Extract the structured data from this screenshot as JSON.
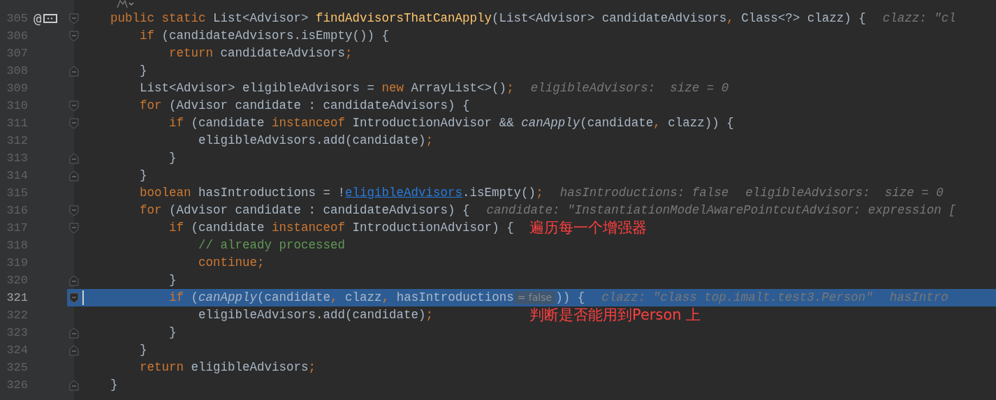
{
  "lines": [
    {
      "number": "305",
      "current": false,
      "fold_open": true,
      "fold_close": false,
      "gutter_text": "@",
      "debug_badge": true,
      "tokens": [
        {
          "kind": "keyword",
          "text": "public static "
        },
        {
          "kind": "plain",
          "text": "List<Advisor> "
        },
        {
          "kind": "method",
          "text": "findAdvisorsThatCanApply"
        },
        {
          "kind": "plain",
          "text": "(List<Advisor> candidateAdvisors"
        },
        {
          "kind": "punct",
          "text": ", "
        },
        {
          "kind": "plain",
          "text": "Class<?> clazz) {"
        },
        {
          "kind": "hint",
          "text": "clazz: \"cl"
        }
      ]
    },
    {
      "number": "306",
      "current": false,
      "fold_open": true,
      "fold_close": false,
      "debug_badge": false,
      "tokens": [
        {
          "kind": "keyword",
          "text": "    if "
        },
        {
          "kind": "plain",
          "text": "(candidateAdvisors.isEmpty()) {"
        }
      ]
    },
    {
      "number": "307",
      "current": false,
      "fold_open": false,
      "fold_close": false,
      "debug_badge": false,
      "tokens": [
        {
          "kind": "keyword",
          "text": "        return "
        },
        {
          "kind": "plain",
          "text": "candidateAdvisors"
        },
        {
          "kind": "punct",
          "text": ";"
        }
      ]
    },
    {
      "number": "308",
      "current": false,
      "fold_open": false,
      "fold_close": true,
      "debug_badge": false,
      "tokens": [
        {
          "kind": "plain",
          "text": "    }"
        }
      ]
    },
    {
      "number": "309",
      "current": false,
      "fold_open": false,
      "fold_close": false,
      "debug_badge": false,
      "tokens": [
        {
          "kind": "plain",
          "text": "    List<Advisor> eligibleAdvisors = "
        },
        {
          "kind": "keyword",
          "text": "new "
        },
        {
          "kind": "plain",
          "text": "ArrayList<>()"
        },
        {
          "kind": "punct",
          "text": ";"
        },
        {
          "kind": "hint",
          "text": "eligibleAdvisors:  size = 0"
        }
      ]
    },
    {
      "number": "310",
      "current": false,
      "fold_open": true,
      "fold_close": false,
      "debug_badge": false,
      "tokens": [
        {
          "kind": "keyword",
          "text": "    for "
        },
        {
          "kind": "plain",
          "text": "(Advisor candidate : candidateAdvisors) {"
        }
      ]
    },
    {
      "number": "311",
      "current": false,
      "fold_open": true,
      "fold_close": false,
      "debug_badge": false,
      "tokens": [
        {
          "kind": "keyword",
          "text": "        if "
        },
        {
          "kind": "plain",
          "text": "(candidate "
        },
        {
          "kind": "keyword",
          "text": "instanceof "
        },
        {
          "kind": "plain",
          "text": "IntroductionAdvisor && "
        },
        {
          "kind": "italic",
          "text": "canApply"
        },
        {
          "kind": "plain",
          "text": "(candidate"
        },
        {
          "kind": "punct",
          "text": ", "
        },
        {
          "kind": "plain",
          "text": "clazz)) {"
        }
      ]
    },
    {
      "number": "312",
      "current": false,
      "fold_open": false,
      "fold_close": false,
      "debug_badge": false,
      "tokens": [
        {
          "kind": "plain",
          "text": "            eligibleAdvisors.add(candidate)"
        },
        {
          "kind": "punct",
          "text": ";"
        }
      ]
    },
    {
      "number": "313",
      "current": false,
      "fold_open": false,
      "fold_close": true,
      "debug_badge": false,
      "tokens": [
        {
          "kind": "plain",
          "text": "        }"
        }
      ]
    },
    {
      "number": "314",
      "current": false,
      "fold_open": false,
      "fold_close": true,
      "debug_badge": false,
      "tokens": [
        {
          "kind": "plain",
          "text": "    }"
        }
      ]
    },
    {
      "number": "315",
      "current": false,
      "fold_open": false,
      "fold_close": false,
      "debug_badge": false,
      "tokens": [
        {
          "kind": "keyword",
          "text": "    boolean "
        },
        {
          "kind": "plain",
          "text": "hasIntroductions = !"
        },
        {
          "kind": "link",
          "text": "eligibleAdvisors"
        },
        {
          "kind": "plain",
          "text": ".isEmpty()"
        },
        {
          "kind": "punct",
          "text": ";"
        },
        {
          "kind": "hint",
          "text": "hasIntroductions: false"
        },
        {
          "kind": "hint",
          "text": "eligibleAdvisors:  size = 0"
        }
      ]
    },
    {
      "number": "316",
      "current": false,
      "fold_open": true,
      "fold_close": false,
      "debug_badge": false,
      "tokens": [
        {
          "kind": "keyword",
          "text": "    for "
        },
        {
          "kind": "plain",
          "text": "(Advisor candidate : candidateAdvisors) {"
        },
        {
          "kind": "hint",
          "text": "candidate: \"InstantiationModelAwarePointcutAdvisor: expression ["
        }
      ]
    },
    {
      "number": "317",
      "current": false,
      "fold_open": true,
      "fold_close": false,
      "debug_badge": false,
      "note": "遍历每一个增强器",
      "tokens": [
        {
          "kind": "keyword",
          "text": "        if "
        },
        {
          "kind": "plain",
          "text": "(candidate "
        },
        {
          "kind": "keyword",
          "text": "instanceof "
        },
        {
          "kind": "plain",
          "text": "IntroductionAdvisor) {"
        }
      ]
    },
    {
      "number": "318",
      "current": false,
      "fold_open": false,
      "fold_close": false,
      "debug_badge": false,
      "tokens": [
        {
          "kind": "comment",
          "text": "            // already processed"
        }
      ]
    },
    {
      "number": "319",
      "current": false,
      "fold_open": false,
      "fold_close": false,
      "debug_badge": false,
      "tokens": [
        {
          "kind": "keyword",
          "text": "            continue"
        },
        {
          "kind": "punct",
          "text": ";"
        }
      ]
    },
    {
      "number": "320",
      "current": false,
      "fold_open": false,
      "fold_close": true,
      "debug_badge": false,
      "tokens": [
        {
          "kind": "plain",
          "text": "        }"
        }
      ]
    },
    {
      "number": "321",
      "current": true,
      "fold_open": true,
      "fold_close": false,
      "debug_badge": false,
      "tokens": [
        {
          "kind": "keyword",
          "text": "        if "
        },
        {
          "kind": "plain",
          "text": "("
        },
        {
          "kind": "italic",
          "text": "canApply"
        },
        {
          "kind": "plain",
          "text": "(candidate"
        },
        {
          "kind": "punct",
          "text": ", "
        },
        {
          "kind": "plain",
          "text": "clazz"
        },
        {
          "kind": "punct",
          "text": ", "
        },
        {
          "kind": "plain",
          "text": "hasIntroductions"
        },
        {
          "kind": "inlay",
          "text": "= false"
        },
        {
          "kind": "plain",
          "text": ")) {"
        },
        {
          "kind": "hint",
          "text": "clazz: \"class top.imalt.test3.Person\""
        },
        {
          "kind": "hint",
          "text": "hasIntro"
        }
      ]
    },
    {
      "number": "322",
      "current": false,
      "fold_open": false,
      "fold_close": false,
      "debug_badge": false,
      "note": "判断是否能用到Person 上",
      "tokens": [
        {
          "kind": "plain",
          "text": "            eligibleAdvisors.add(candidate)"
        },
        {
          "kind": "punct",
          "text": ";"
        }
      ]
    },
    {
      "number": "323",
      "current": false,
      "fold_open": false,
      "fold_close": true,
      "debug_badge": false,
      "tokens": [
        {
          "kind": "plain",
          "text": "        }"
        }
      ]
    },
    {
      "number": "324",
      "current": false,
      "fold_open": false,
      "fold_close": true,
      "debug_badge": false,
      "tokens": [
        {
          "kind": "plain",
          "text": "    }"
        }
      ]
    },
    {
      "number": "325",
      "current": false,
      "fold_open": false,
      "fold_close": false,
      "debug_badge": false,
      "tokens": [
        {
          "kind": "keyword",
          "text": "    return "
        },
        {
          "kind": "plain",
          "text": "eligibleAdvisors"
        },
        {
          "kind": "punct",
          "text": ";"
        }
      ]
    },
    {
      "number": "326",
      "current": false,
      "fold_open": false,
      "fold_close": true,
      "debug_badge": false,
      "tokens": [
        {
          "kind": "plain",
          "text": "}"
        }
      ]
    }
  ]
}
